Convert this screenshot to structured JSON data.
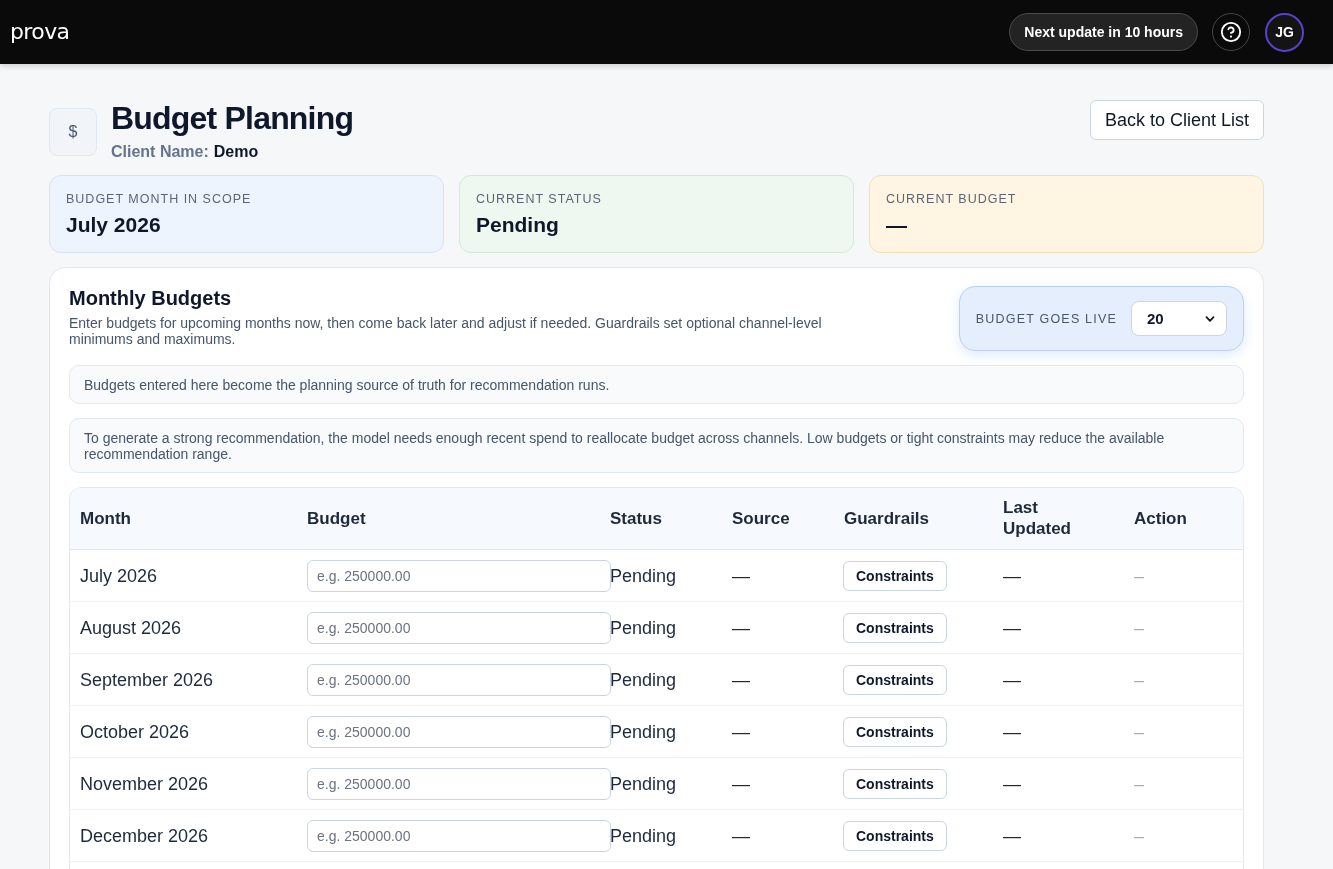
{
  "top_bar": {
    "logo": "prova",
    "update_pill": "Next update in 10 hours",
    "avatar": "JG"
  },
  "header": {
    "icon": "$",
    "title": "Budget Planning",
    "client_label": "Client Name:",
    "client_value": "Demo",
    "back_button": "Back to Client List"
  },
  "stats": [
    {
      "label": "BUDGET MONTH IN SCOPE",
      "value": "July 2026",
      "color": "#eef4fe"
    },
    {
      "label": "CURRENT STATUS",
      "value": "Pending",
      "color": "#eff8f0"
    },
    {
      "label": "CURRENT BUDGET",
      "value": "—",
      "color": "#fff5e2"
    }
  ],
  "monthly_budgets": {
    "title": "Monthly Budgets",
    "description": "Enter budgets for upcoming months now, then come back later and adjust if needed. Guardrails set optional channel-level minimums and maximums.",
    "go_live": {
      "label": "BUDGET GOES LIVE",
      "value": "20"
    },
    "notes": [
      "Budgets entered here become the planning source of truth for recommendation runs.",
      "To generate a strong recommendation, the model needs enough recent spend to reallocate budget across channels. Low budgets or tight constraints may reduce the available recommendation range."
    ],
    "table": {
      "columns": [
        "Month",
        "Budget",
        "Status",
        "Source",
        "Guardrails",
        "Last Updated",
        "Action"
      ],
      "rows": [
        {
          "month": "July 2026",
          "budget": {
            "placeholder": "e.g. 250000.00"
          },
          "status": "Pending",
          "source": "—",
          "guardrails": "Constraints",
          "last_updated": "—",
          "action": "–"
        },
        {
          "month": "August 2026",
          "budget": {
            "placeholder": "e.g. 250000.00"
          },
          "status": "Pending",
          "source": "—",
          "guardrails": "Constraints",
          "last_updated": "—",
          "action": "–"
        },
        {
          "month": "September 2026",
          "budget": {
            "placeholder": "e.g. 250000.00"
          },
          "status": "Pending",
          "source": "—",
          "guardrails": "Constraints",
          "last_updated": "—",
          "action": "–"
        },
        {
          "month": "October 2026",
          "budget": {
            "placeholder": "e.g. 250000.00"
          },
          "status": "Pending",
          "source": "—",
          "guardrails": "Constraints",
          "last_updated": "—",
          "action": "–"
        },
        {
          "month": "November 2026",
          "budget": {
            "placeholder": "e.g. 250000.00"
          },
          "status": "Pending",
          "source": "—",
          "guardrails": "Constraints",
          "last_updated": "—",
          "action": "–"
        },
        {
          "month": "December 2026",
          "budget": {
            "placeholder": "e.g. 250000.00"
          },
          "status": "Pending",
          "source": "—",
          "guardrails": "Constraints",
          "last_updated": "—",
          "action": "–"
        }
      ]
    }
  }
}
